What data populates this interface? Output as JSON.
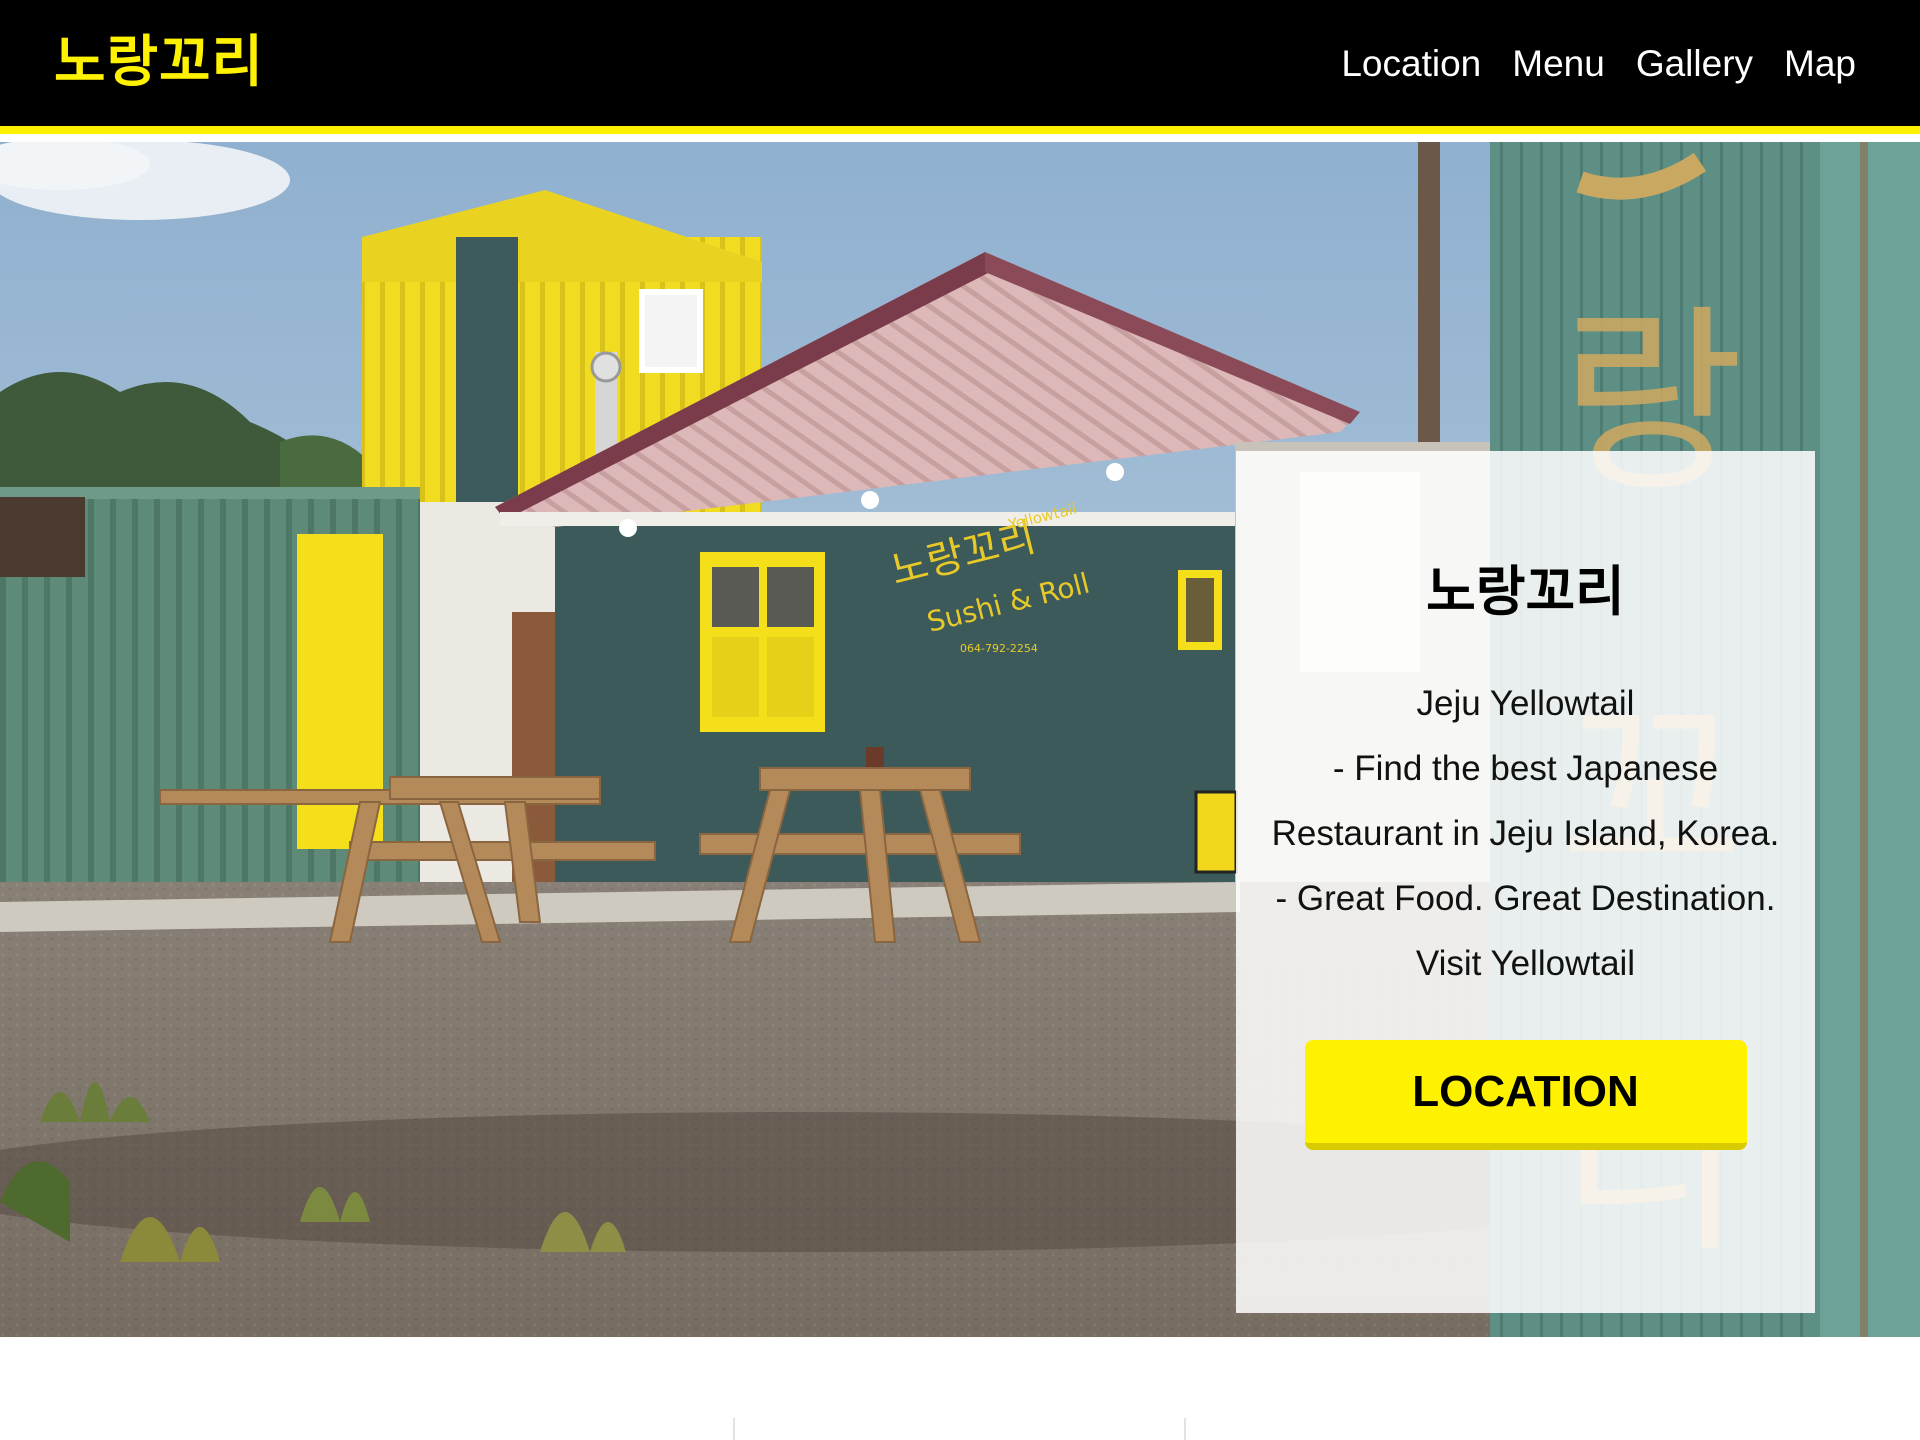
{
  "nav": {
    "brand": "노랑꼬리",
    "links": [
      {
        "label": "Location"
      },
      {
        "label": "Menu"
      },
      {
        "label": "Gallery"
      },
      {
        "label": "Map"
      }
    ]
  },
  "hero": {
    "sign_main": "노랑꼬리",
    "sign_small": "Yellowtail",
    "sign_sub": "Sushi & Roll",
    "sign_phone": "064-792-2254"
  },
  "card": {
    "title": "노랑꼬리",
    "lines": [
      "Jeju Yellowtail",
      "- Find the best Japanese",
      "Restaurant in Jeju Island, Korea.",
      "- Great Food. Great Destination.",
      "Visit Yellowtail"
    ],
    "button_label": "LOCATION"
  },
  "colors": {
    "brand_yellow": "#fff200",
    "navbar_bg": "#000000",
    "building_teal": "#3c5a5a"
  }
}
